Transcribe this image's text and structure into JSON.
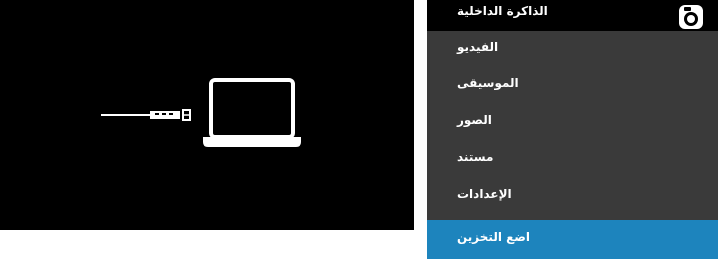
{
  "storage": {
    "title": "الذاكرة الداخلية",
    "items": [
      {
        "label": "الفيديو"
      },
      {
        "label": "الموسيقى"
      },
      {
        "label": "الصور"
      },
      {
        "label": "مستند"
      },
      {
        "label": "الإعدادات"
      },
      {
        "label": "اضع التخزين"
      }
    ],
    "selected_index": 5
  },
  "icons": {
    "camera": "camera-icon",
    "usb": "usb-plug-icon",
    "laptop": "laptop-icon"
  },
  "colors": {
    "selected": "#1d84bd",
    "menu_background": "#3a3a3a",
    "header_background": "#000000"
  }
}
